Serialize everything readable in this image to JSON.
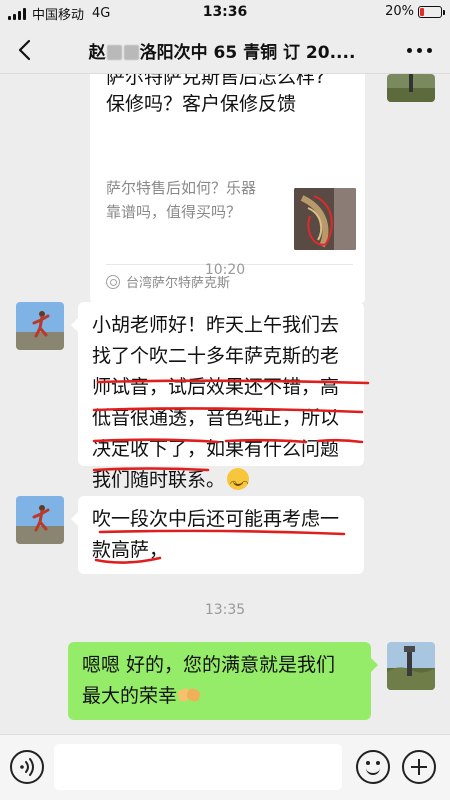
{
  "status_bar": {
    "carrier": "中国移动",
    "network": "4G",
    "time": "13:36",
    "battery_text": "20%",
    "battery_level": 0.2
  },
  "nav": {
    "title_prefix": "赵",
    "title_suffix": "洛阳次中 65 青铜 订 20....",
    "back_icon": "chevron-left-icon",
    "more_icon": "more-dots-icon"
  },
  "link_card": {
    "title_line1": "萨尔特萨克斯售后怎么样?",
    "title_line2": "保修吗？客户保修反馈",
    "desc_line1": "萨尔特售后如何？乐器",
    "desc_line2": "靠谱吗，值得买吗？",
    "source": "台湾萨尔特萨克斯"
  },
  "messages": [
    {
      "timestamp": "10:20",
      "sender": "contact",
      "lines": [
        "小胡老师好！昨天上午我们去",
        "找了个吹二十多年萨克斯的老",
        "师试音，试后效果还不错，高",
        "低音很通透，音色纯正，所以",
        "决定收下了，如果有什么问题",
        "我们随时联系。"
      ],
      "emoji": "smile-emoji"
    },
    {
      "sender": "contact",
      "lines": [
        "吹一段次中后还可能再考虑一",
        "款高萨，"
      ]
    },
    {
      "timestamp": "13:35",
      "sender": "me",
      "lines": [
        "嗯嗯 好的，您的满意就是我们",
        "最大的荣幸"
      ],
      "emoji": "handshake-emoji"
    }
  ],
  "input_bar": {
    "voice_icon": "voice-icon",
    "emoji_icon": "emoji-icon",
    "plus_icon": "plus-icon",
    "input_value": ""
  },
  "colors": {
    "background": "#ededed",
    "my_bubble": "#95ec69",
    "their_bubble": "#ffffff",
    "annotation_red": "#e01e1e"
  }
}
